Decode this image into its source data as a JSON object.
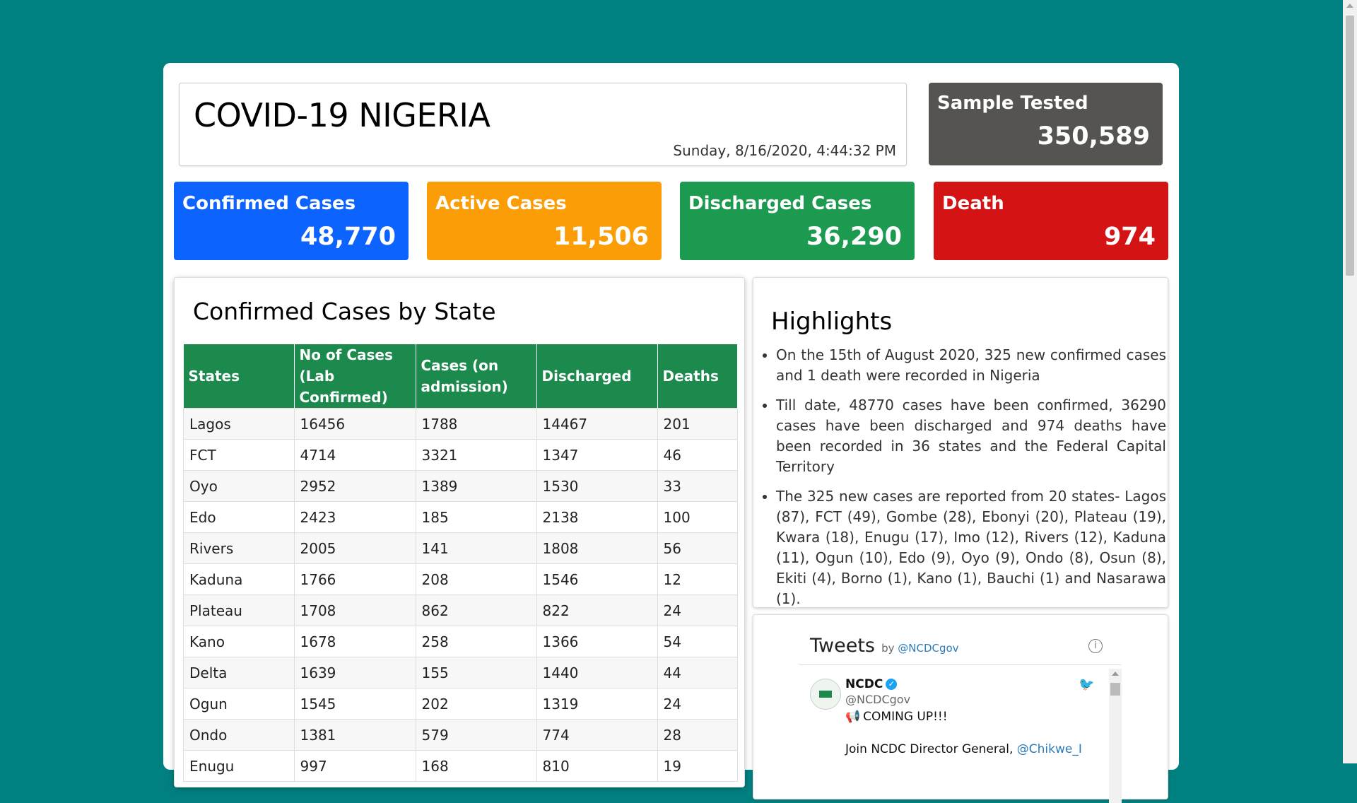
{
  "header": {
    "title": "COVID-19 NIGERIA",
    "datetime": "Sunday, 8/16/2020, 4:44:32 PM"
  },
  "sample_tested": {
    "label": "Sample Tested",
    "value": "350,589"
  },
  "stats": {
    "confirmed": {
      "label": "Confirmed Cases",
      "value": "48,770"
    },
    "active": {
      "label": "Active Cases",
      "value": "11,506"
    },
    "discharged": {
      "label": "Discharged Cases",
      "value": "36,290"
    },
    "death": {
      "label": "Death",
      "value": "974"
    }
  },
  "colors": {
    "background": "#008080",
    "confirmed": "#0d63fd",
    "active": "#fb9d07",
    "discharged": "#1c9a4f",
    "death": "#d41414",
    "sample": "#555450",
    "table_header": "#1c8a4d"
  },
  "state_table": {
    "title": "Confirmed Cases by State",
    "headers": [
      "States",
      "No of Cases (Lab Confirmed)",
      "Cases (on admission)",
      "Discharged",
      "Deaths"
    ],
    "rows": [
      [
        "Lagos",
        "16456",
        "1788",
        "14467",
        "201"
      ],
      [
        "FCT",
        "4714",
        "3321",
        "1347",
        "46"
      ],
      [
        "Oyo",
        "2952",
        "1389",
        "1530",
        "33"
      ],
      [
        "Edo",
        "2423",
        "185",
        "2138",
        "100"
      ],
      [
        "Rivers",
        "2005",
        "141",
        "1808",
        "56"
      ],
      [
        "Kaduna",
        "1766",
        "208",
        "1546",
        "12"
      ],
      [
        "Plateau",
        "1708",
        "862",
        "822",
        "24"
      ],
      [
        "Kano",
        "1678",
        "258",
        "1366",
        "54"
      ],
      [
        "Delta",
        "1639",
        "155",
        "1440",
        "44"
      ],
      [
        "Ogun",
        "1545",
        "202",
        "1319",
        "24"
      ],
      [
        "Ondo",
        "1381",
        "579",
        "774",
        "28"
      ],
      [
        "Enugu",
        "997",
        "168",
        "810",
        "19"
      ]
    ]
  },
  "highlights": {
    "title": "Highlights",
    "items": [
      "On the 15th of August 2020, 325 new confirmed cases and 1 death were recorded in Nigeria",
      "Till date, 48770 cases have been confirmed, 36290 cases have been discharged and 974 deaths have been recorded in 36 states and the Federal Capital Territory",
      "The 325 new cases are reported from 20 states- Lagos (87), FCT (49), Gombe (28), Ebonyi (20), Plateau (19), Kwara (18), Enugu (17), Imo (12), Rivers (12), Kaduna (11), Ogun (10), Edo (9), Oyo (9), Ondo (8), Osun (8), Ekiti (4), Borno (1), Kano (1), Bauchi (1) and Nasarawa (1)."
    ]
  },
  "tweets": {
    "title": "Tweets",
    "by": "by",
    "handle_link": "@NCDCgov",
    "author_name": "NCDC",
    "author_handle": "@NCDCgov",
    "text_line1": "COMING UP!!!",
    "text_line2": "Join NCDC Director General,",
    "mention": "@Chikwe_I"
  }
}
